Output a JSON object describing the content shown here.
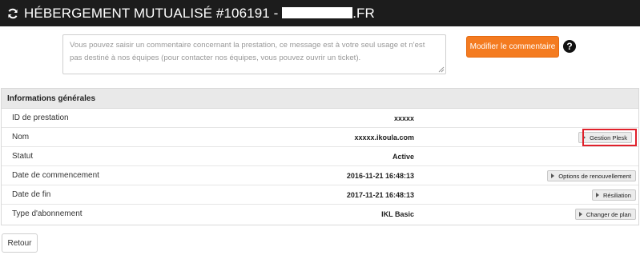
{
  "header": {
    "title_prefix": "HÉBERGEMENT MUTUALISÉ #106191 -",
    "title_suffix": ".FR"
  },
  "comment": {
    "placeholder": "Vous pouvez saisir un commentaire concernant la prestation, ce message est à votre seul usage et n'est pas destiné à nos équipes (pour contacter nos équipes, vous pouvez ouvrir un ticket).",
    "button_label": "Modifier le commentaire",
    "help_symbol": "?"
  },
  "panel": {
    "title": "Informations générales",
    "rows": [
      {
        "label": "ID de prestation",
        "value": "xxxxx",
        "action": ""
      },
      {
        "label": "Nom",
        "value": "xxxxx.ikoula.com",
        "action": "Gestion Plesk"
      },
      {
        "label": "Statut",
        "value": "Active",
        "action": ""
      },
      {
        "label": "Date de commencement",
        "value": "2016-11-21 16:48:13",
        "action": "Options de renouvellement"
      },
      {
        "label": "Date de fin",
        "value": "2017-11-21 16:48:13",
        "action": "Résiliation"
      },
      {
        "label": "Type d'abonnement",
        "value": "IKL Basic",
        "action": "Changer de plan"
      }
    ]
  },
  "footer": {
    "back_label": "Retour"
  },
  "colors": {
    "topbar": "#1c1c1c",
    "accent": "#f47b20",
    "highlight": "#e0202a"
  }
}
